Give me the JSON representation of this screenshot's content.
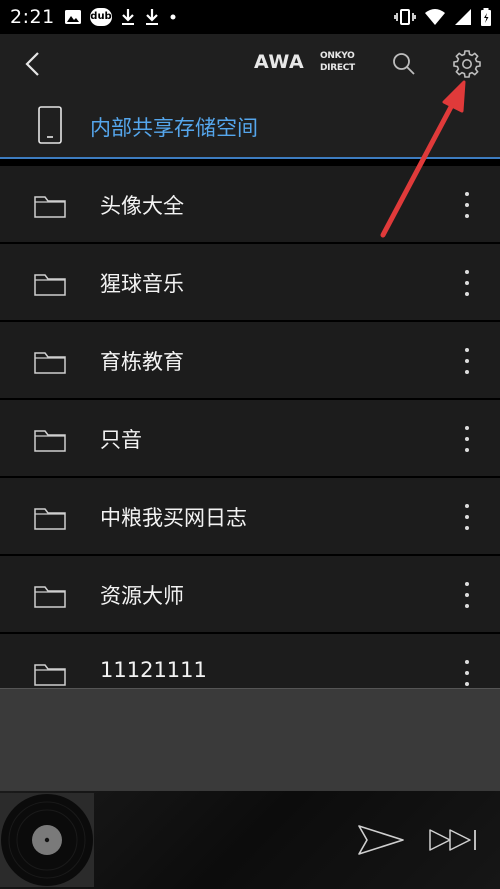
{
  "status_bar": {
    "time": "2:21",
    "left_icons": [
      "image-icon",
      "dub-icon",
      "download-icon",
      "download-icon",
      "dot-icon"
    ],
    "dub_label": "dub",
    "right_icons": [
      "vibrate-icon",
      "wifi-icon",
      "signal-icon",
      "battery-icon"
    ]
  },
  "toolbar": {
    "awa_label": "AWA",
    "onkyo_line1": "ONKYO",
    "onkyo_line2": "DIRECT"
  },
  "storage": {
    "label": "内部共享存储空间"
  },
  "folders": [
    {
      "name": "头像大全"
    },
    {
      "name": "猩球音乐"
    },
    {
      "name": "育栋教育"
    },
    {
      "name": "只音"
    },
    {
      "name": "中粮我买网日志"
    },
    {
      "name": "资源大师"
    },
    {
      "name": "11121111"
    }
  ],
  "colors": {
    "accent": "#55a6ec",
    "annotation_arrow": "#e03a3a"
  }
}
